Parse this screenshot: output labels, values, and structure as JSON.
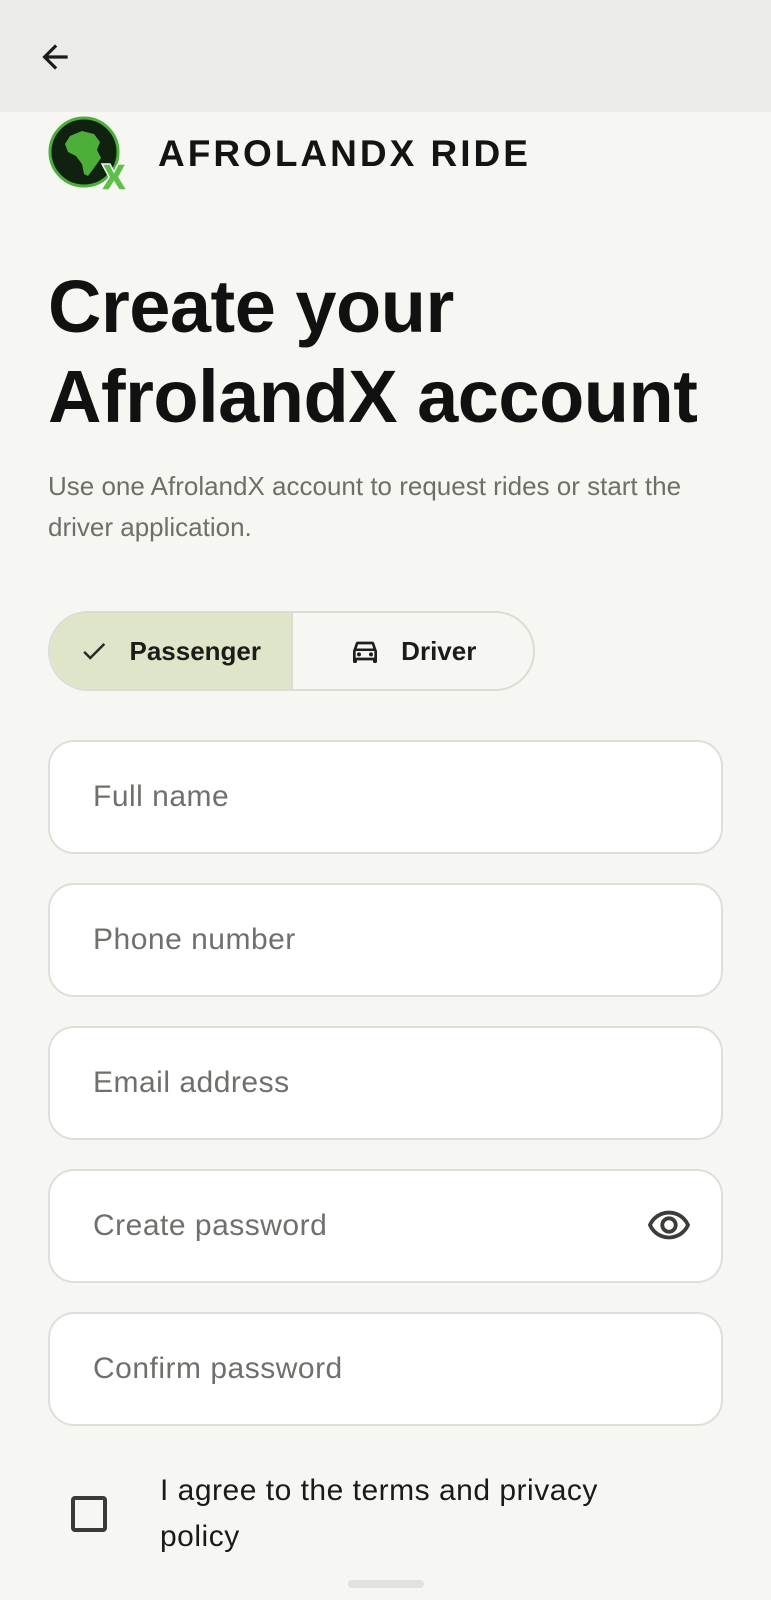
{
  "brand": {
    "name": "AFROLANDX RIDE"
  },
  "header": {
    "title_line1": "Create your",
    "title_line2": "AfrolandX account",
    "subtitle": "Use one AfrolandX account to request rides or start the driver application."
  },
  "role_toggle": {
    "passenger_label": "Passenger",
    "driver_label": "Driver",
    "selected": "Passenger"
  },
  "form": {
    "full_name_placeholder": "Full name",
    "phone_placeholder": "Phone number",
    "email_placeholder": "Email address",
    "password_placeholder": "Create password",
    "confirm_password_placeholder": "Confirm password",
    "terms_label": "I agree to the terms and privacy policy",
    "terms_checked": false
  },
  "icons": {
    "back": "arrow-left-icon",
    "selected_check": "check-icon",
    "driver": "car-icon",
    "password_visibility": "eye-icon",
    "logo": "africa-map-logo"
  },
  "colors": {
    "background": "#f6f6f3",
    "app_bar": "#ebebe7",
    "selected_segment": "#dfe5c9",
    "brand_green": "#4caf3a",
    "logo_dark": "#10220f"
  }
}
